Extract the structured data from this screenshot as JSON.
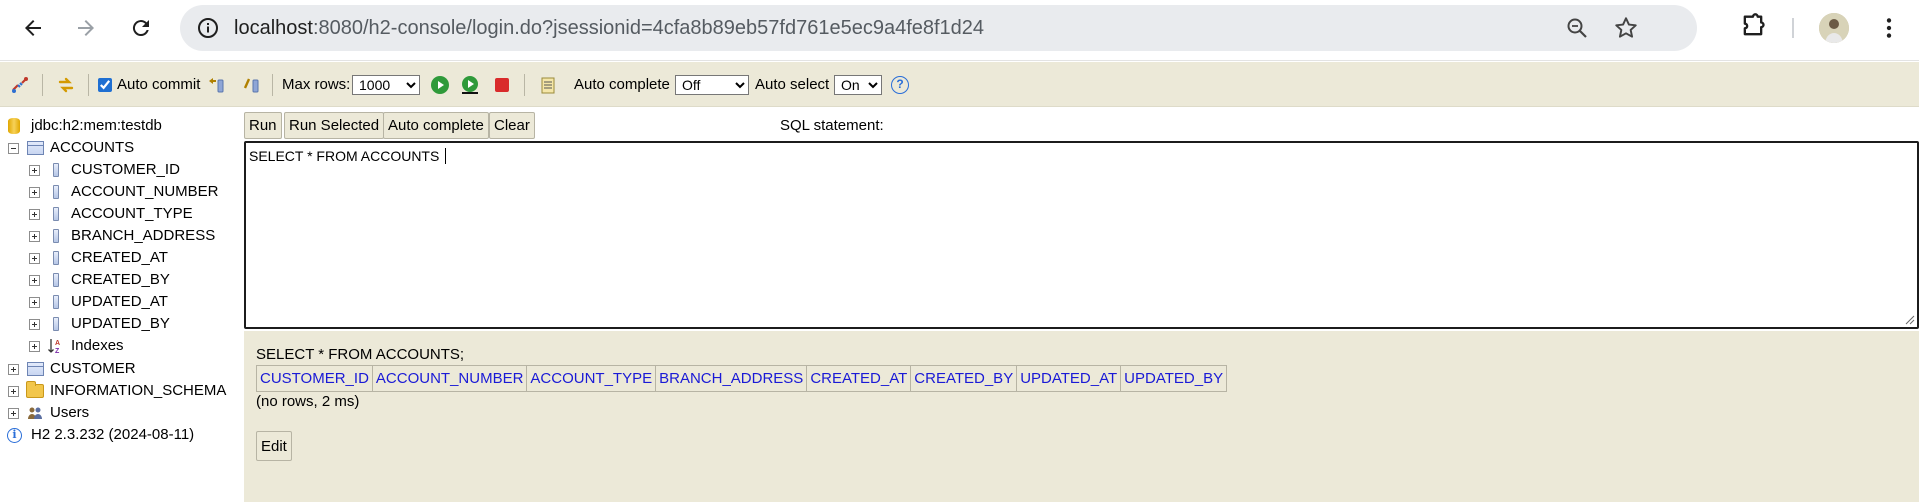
{
  "browser": {
    "url_host": "localhost",
    "url_rest": ":8080/h2-console/login.do?jsessionid=4cfa8b89eb57fd761e5ec9a4fe8f1d24",
    "icons": [
      "back-icon",
      "forward-icon",
      "reload-icon",
      "site-info-icon",
      "zoom-icon",
      "bookmark-star-icon",
      "extensions-icon",
      "profile-avatar",
      "menu-kebab-icon"
    ]
  },
  "toolbar": {
    "auto_commit_label": "Auto commit",
    "auto_commit_checked": true,
    "max_rows_label": "Max rows:",
    "max_rows_value": "1000",
    "auto_complete_label": "Auto complete",
    "auto_complete_value": "Off",
    "auto_select_label": "Auto select",
    "auto_select_value": "On",
    "help_glyph": "?"
  },
  "tree": {
    "connection": "jdbc:h2:mem:testdb",
    "accounts_table": "ACCOUNTS",
    "columns": [
      "CUSTOMER_ID",
      "ACCOUNT_NUMBER",
      "ACCOUNT_TYPE",
      "BRANCH_ADDRESS",
      "CREATED_AT",
      "CREATED_BY",
      "UPDATED_AT",
      "UPDATED_BY"
    ],
    "indexes": "Indexes",
    "customer_table": "CUSTOMER",
    "information_schema": "INFORMATION_SCHEMA",
    "users": "Users",
    "version": "H2 2.3.232 (2024-08-11)"
  },
  "query": {
    "run": "Run",
    "run_selected": "Run Selected",
    "auto_complete": "Auto complete",
    "clear": "Clear",
    "sql_label": "SQL statement:",
    "sql_text": "SELECT * FROM ACCOUNTS "
  },
  "results": {
    "executed_sql": "SELECT * FROM ACCOUNTS;",
    "headers": [
      "CUSTOMER_ID",
      "ACCOUNT_NUMBER",
      "ACCOUNT_TYPE",
      "BRANCH_ADDRESS",
      "CREATED_AT",
      "CREATED_BY",
      "UPDATED_AT",
      "UPDATED_BY"
    ],
    "info": "(no rows, 2 ms)",
    "edit": "Edit"
  },
  "colors": {
    "panel": "#ece9d8",
    "header_link": "#1a1ad6",
    "omnibox": "#e9ebee"
  }
}
